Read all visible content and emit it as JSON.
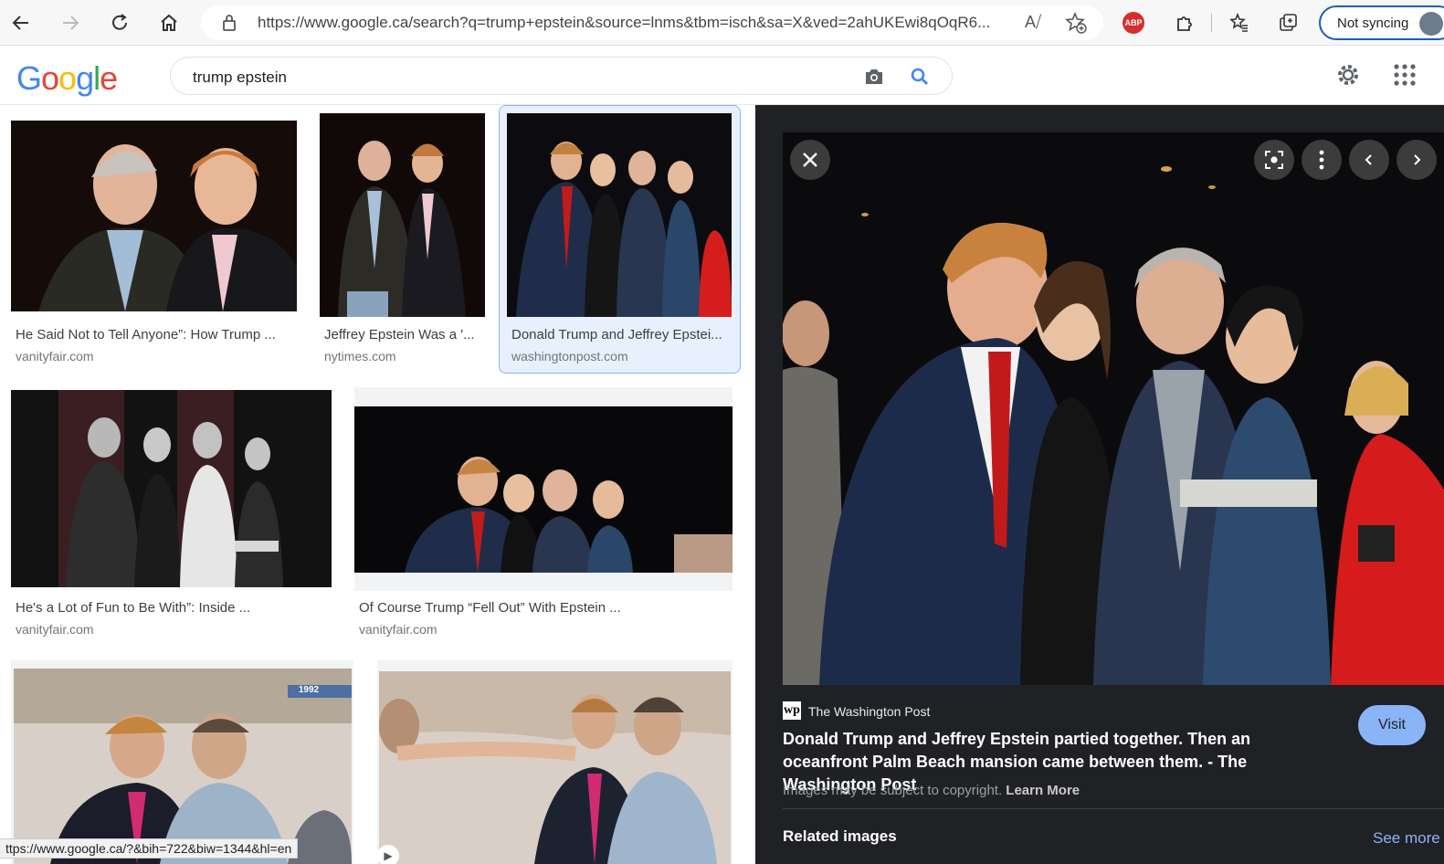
{
  "browser": {
    "url": "https://www.google.ca/search?q=trump+epstein&source=lnms&tbm=isch&sa=X&ved=2ahUKEwi8qOqR6...",
    "sync_label": "Not syncing",
    "abp_label": "ABP"
  },
  "google": {
    "logo": "Google",
    "query": "trump epstein"
  },
  "results": [
    {
      "title": "He Said Not to Tell Anyone”: How Trump ...",
      "site": "vanityfair.com"
    },
    {
      "title": "Jeffrey Epstein Was a '...",
      "site": "nytimes.com"
    },
    {
      "title": "Donald Trump and Jeffrey Epstei...",
      "site": "washingtonpost.com"
    },
    {
      "title": "He's a Lot of Fun to Be With”: Inside ...",
      "site": "vanityfair.com"
    },
    {
      "title": "Of Course Trump “Fell Out” With Epstein ...",
      "site": "vanityfair.com"
    }
  ],
  "thumb_badge": "1992",
  "status_url": "ttps://www.google.ca/?&bih=722&biw=1344&hl=en",
  "viewer": {
    "source": "The Washington Post",
    "source_icon": "wp",
    "title": "Donald Trump and Jeffrey Epstein partied together. Then an oceanfront Palm Beach mansion came between them. - The Washington Post",
    "visit_label": "Visit",
    "copyright_text": "Images may be subject to copyright.",
    "learn_more": "Learn More",
    "related_label": "Related images",
    "see_more_label": "See more"
  },
  "colors": {
    "accent": "#1a73e8",
    "viewer_bg": "#202124",
    "visit_bg": "#8ab4f8"
  }
}
